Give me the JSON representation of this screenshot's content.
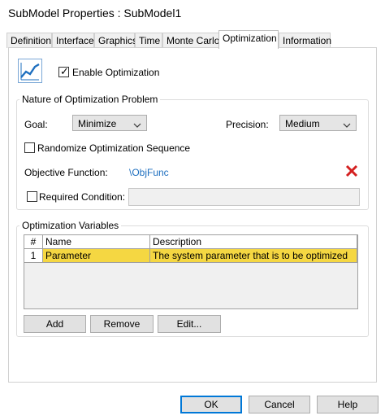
{
  "window": {
    "title": "SubModel Properties : SubModel1"
  },
  "tabs": [
    {
      "label": "Definition"
    },
    {
      "label": "Interface"
    },
    {
      "label": "Graphics"
    },
    {
      "label": "Time"
    },
    {
      "label": "Monte Carlo"
    },
    {
      "label": "Optimization"
    },
    {
      "label": "Information"
    }
  ],
  "active_tab": "Optimization",
  "optimization": {
    "enable_label": "Enable Optimization",
    "enable_checked": true
  },
  "nature": {
    "group_label": "Nature of Optimization Problem",
    "goal_label": "Goal:",
    "goal_value": "Minimize",
    "precision_label": "Precision:",
    "precision_value": "Medium",
    "randomize_label": "Randomize Optimization Sequence",
    "objective_label": "Objective Function:",
    "objective_value": "\\ObjFunc",
    "required_label": "Required Condition:",
    "required_value": ""
  },
  "variables": {
    "group_label": "Optimization Variables",
    "columns": [
      "#",
      "Name",
      "Description"
    ],
    "rows": [
      {
        "num": "1",
        "name": "Parameter",
        "description": "The system parameter that is to be optimized"
      }
    ],
    "add_label": "Add",
    "remove_label": "Remove",
    "edit_label": "Edit..."
  },
  "footer": {
    "ok_label": "OK",
    "cancel_label": "Cancel",
    "help_label": "Help"
  },
  "colors": {
    "selected_row": "#f5d742",
    "link_blue": "#1e6fbf",
    "delete_red": "#d42020",
    "default_button_border": "#0078d7"
  },
  "icons": {
    "optimization": "chart-line-up-icon",
    "delete": "close-x-icon",
    "dropdown": "chevron-down-icon"
  }
}
